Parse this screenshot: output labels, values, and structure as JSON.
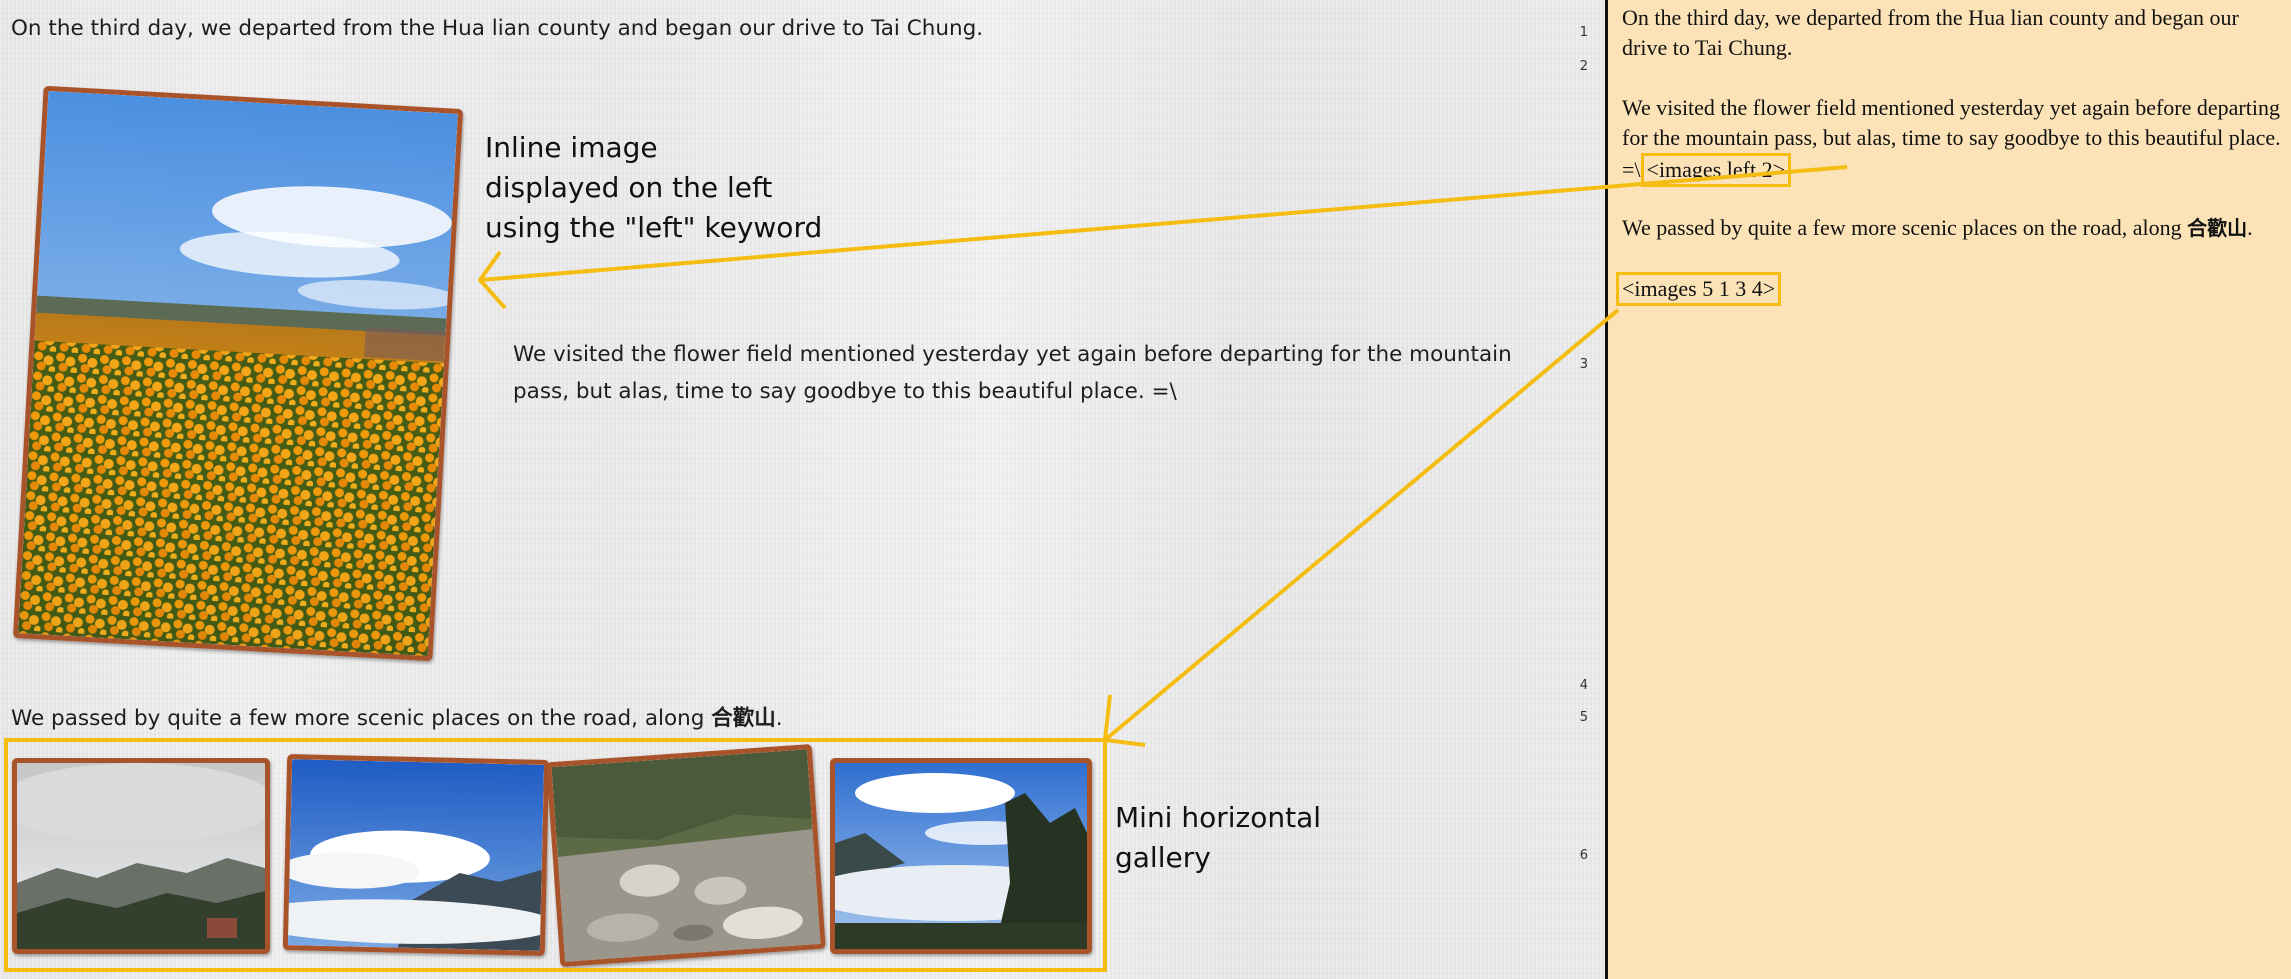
{
  "preview": {
    "para1": "On the third day, we departed from the Hua lian county and began our drive to Tai Chung.",
    "para2": "We visited the flower field mentioned yesterday yet again before departing for the mountain pass, but alas, time to say goodbye to this beautiful place. =\\",
    "para3_text": "We passed by quite a few more scenic places on the road, along ",
    "para3_bold": "合歡山",
    "para3_end": ".",
    "line_numbers": [
      "1",
      "2",
      "3",
      "4",
      "5",
      "6"
    ]
  },
  "annotations": {
    "inline_image": [
      "Inline image",
      "displayed on the left",
      "using the \"left\" keyword"
    ],
    "gallery": [
      "Mini horizontal",
      "gallery"
    ]
  },
  "editor": {
    "line1": "On the third day, we departed from the Hua lian county and began our drive to Tai Chung.",
    "line2_text": "We visited the flower field mentioned yesterday yet again before departing for the mountain pass, but alas, time to say goodbye to this beautiful place. =\\",
    "line2_tag": "<images left 2>",
    "line3_text": "We passed by quite a few more scenic places on the road, along ",
    "line3_bold": "合歡山",
    "line3_end": ".",
    "line4_tag": "<images 5 1 3 4>"
  },
  "colors": {
    "highlight": "#f5bd12",
    "photo_border": "#a9532b",
    "editor_bg": "#fbe2b7"
  }
}
